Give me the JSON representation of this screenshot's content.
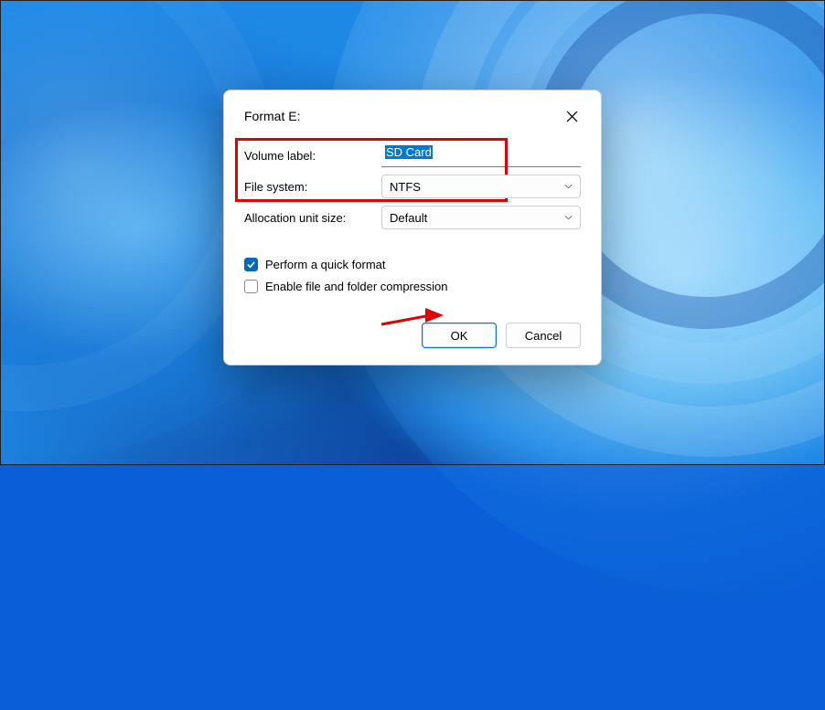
{
  "dialog": {
    "title": "Format E:",
    "volume_label_label": "Volume label:",
    "volume_label_value": "SD Card",
    "file_system_label": "File system:",
    "file_system_value": "NTFS",
    "allocation_label": "Allocation unit size:",
    "allocation_value": "Default",
    "quick_format_label": "Perform a quick format",
    "quick_format_checked": true,
    "compression_label": "Enable file and folder compression",
    "compression_checked": false,
    "ok_label": "OK",
    "cancel_label": "Cancel"
  }
}
